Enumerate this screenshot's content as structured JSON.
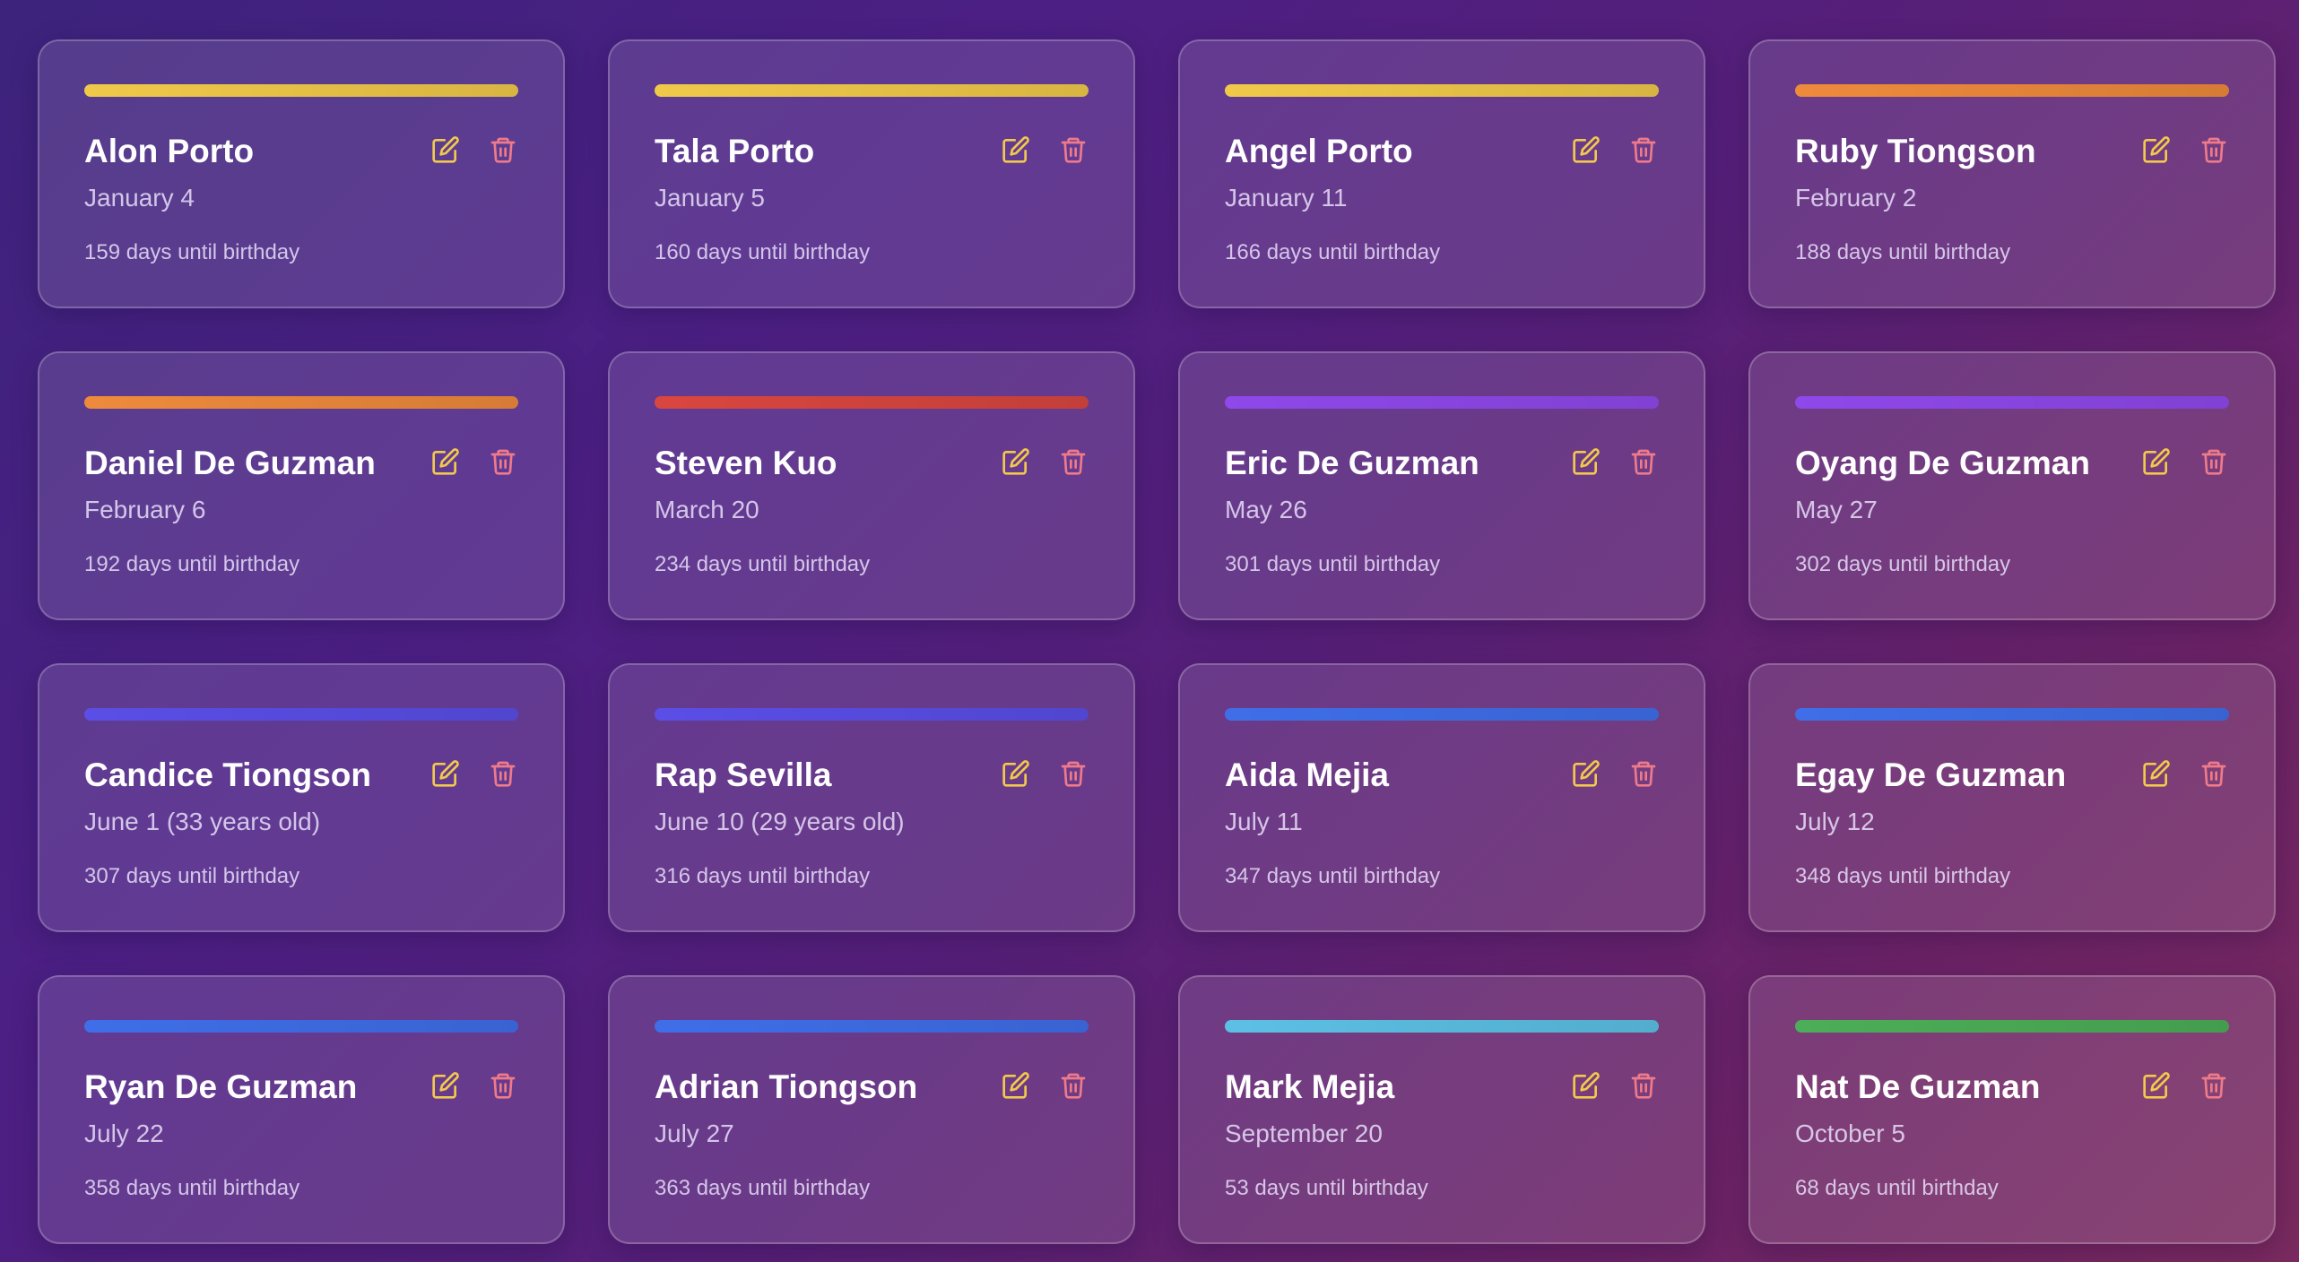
{
  "colors": {
    "gold": "#f0c94a",
    "orange": "#ee8a3c",
    "red": "#d9463f",
    "purple": "#8f48ea",
    "indigo": "#5a4ee6",
    "blue": "#3f6ee8",
    "cyan": "#5cc0e4",
    "green": "#4cae58",
    "edit_icon": "#f2c94c",
    "delete_icon": "#ee7a8a"
  },
  "cards": [
    {
      "name": "Alon Porto",
      "date": "January 4",
      "countdown": "159 days until birthday",
      "accent": "#f0c94a"
    },
    {
      "name": "Tala Porto",
      "date": "January 5",
      "countdown": "160 days until birthday",
      "accent": "#f0c94a"
    },
    {
      "name": "Angel Porto",
      "date": "January 11",
      "countdown": "166 days until birthday",
      "accent": "#f0c94a"
    },
    {
      "name": "Ruby Tiongson",
      "date": "February 2",
      "countdown": "188 days until birthday",
      "accent": "#ee8a3c"
    },
    {
      "name": "Daniel De Guzman",
      "date": "February 6",
      "countdown": "192 days until birthday",
      "accent": "#ee8a3c"
    },
    {
      "name": "Steven Kuo",
      "date": "March 20",
      "countdown": "234 days until birthday",
      "accent": "#d9463f"
    },
    {
      "name": "Eric De Guzman",
      "date": "May 26",
      "countdown": "301 days until birthday",
      "accent": "#8f48ea"
    },
    {
      "name": "Oyang De Guzman",
      "date": "May 27",
      "countdown": "302 days until birthday",
      "accent": "#8f48ea"
    },
    {
      "name": "Candice Tiongson",
      "date": "June 1 (33 years old)",
      "countdown": "307 days until birthday",
      "accent": "#5a4ee6"
    },
    {
      "name": "Rap Sevilla",
      "date": "June 10 (29 years old)",
      "countdown": "316 days until birthday",
      "accent": "#5a4ee6"
    },
    {
      "name": "Aida Mejia",
      "date": "July 11",
      "countdown": "347 days until birthday",
      "accent": "#3f6ee8"
    },
    {
      "name": "Egay De Guzman",
      "date": "July 12",
      "countdown": "348 days until birthday",
      "accent": "#3f6ee8"
    },
    {
      "name": "Ryan De Guzman",
      "date": "July 22",
      "countdown": "358 days until birthday",
      "accent": "#3f6ee8"
    },
    {
      "name": "Adrian Tiongson",
      "date": "July 27",
      "countdown": "363 days until birthday",
      "accent": "#3f6ee8"
    },
    {
      "name": "Mark Mejia",
      "date": "September 20",
      "countdown": "53 days until birthday",
      "accent": "#5cc0e4"
    },
    {
      "name": "Nat De Guzman",
      "date": "October 5",
      "countdown": "68 days until birthday",
      "accent": "#4cae58"
    }
  ]
}
